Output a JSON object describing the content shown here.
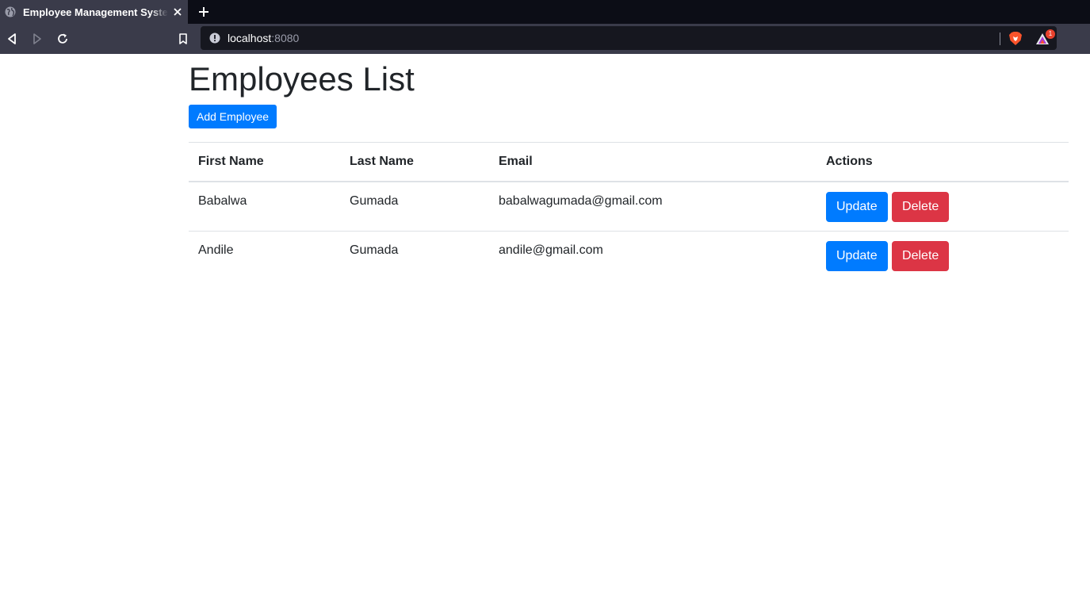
{
  "browser": {
    "tab_title": "Employee Management System",
    "url_host": "localhost",
    "url_port": ":8080",
    "rewards_badge": "1",
    "icons": {
      "tab_favicon": "globe-icon",
      "tab_close": "close-icon",
      "new_tab": "plus-icon",
      "back": "back-arrow-icon",
      "forward": "forward-arrow-icon",
      "reload": "reload-icon",
      "bookmark": "bookmark-icon",
      "site_info": "info-icon",
      "shields": "brave-shields-icon",
      "rewards": "brave-rewards-icon"
    }
  },
  "page": {
    "heading": "Employees List",
    "add_button": "Add Employee",
    "table": {
      "headers": [
        "First Name",
        "Last Name",
        "Email",
        "Actions"
      ],
      "rows": [
        {
          "first_name": "Babalwa",
          "last_name": "Gumada",
          "email": "babalwagumada@gmail.com",
          "update_label": "Update",
          "delete_label": "Delete"
        },
        {
          "first_name": "Andile",
          "last_name": "Gumada",
          "email": "andile@gmail.com",
          "update_label": "Update",
          "delete_label": "Delete"
        }
      ]
    }
  },
  "colors": {
    "primary": "#007bff",
    "danger": "#dc3545",
    "text": "#212529",
    "border": "#dee2e6",
    "chrome_bg": "#3a3b4a",
    "tabstrip_bg": "#0c0d16"
  }
}
